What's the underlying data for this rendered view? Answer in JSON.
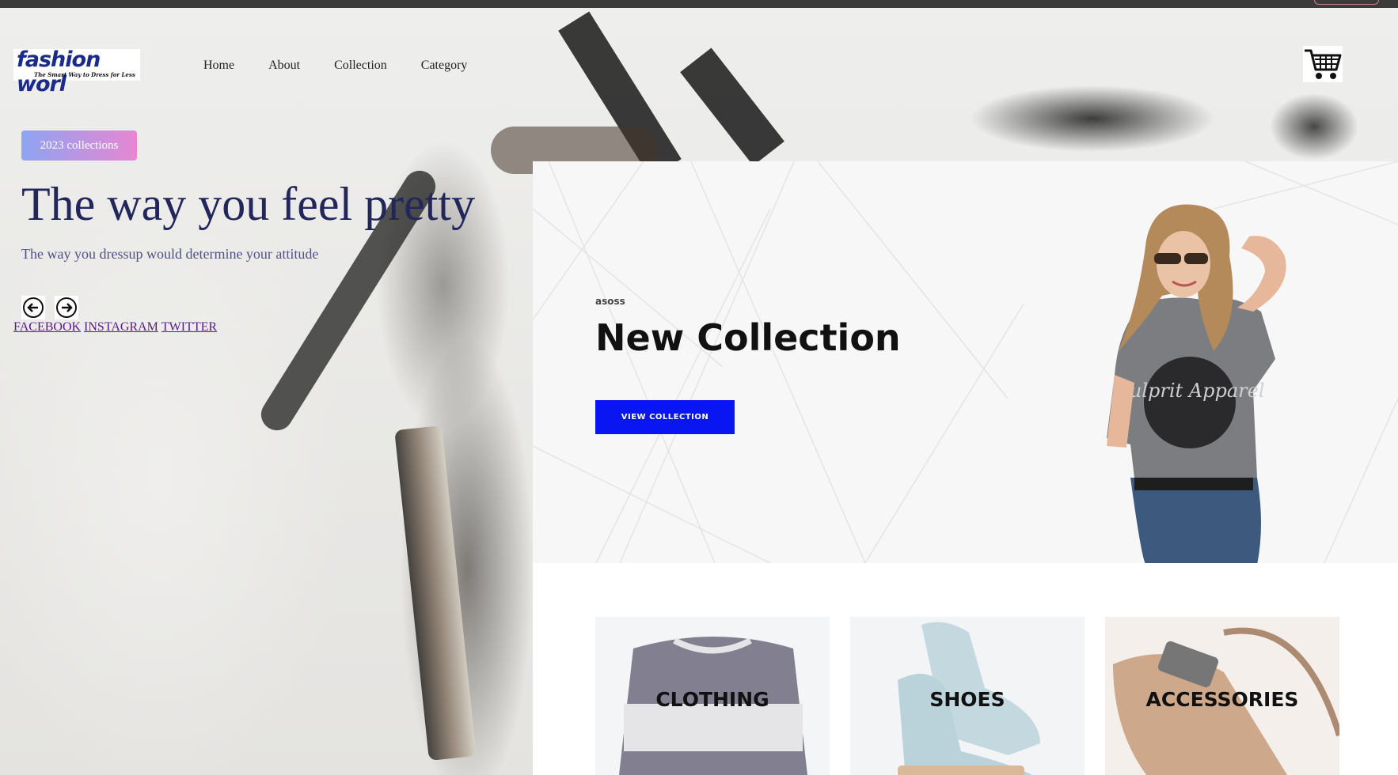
{
  "header": {
    "logo": {
      "name": "fashion worl",
      "tagline": "The Smart Way to Dress for Less"
    },
    "nav": [
      {
        "label": "Home"
      },
      {
        "label": "About"
      },
      {
        "label": "Collection"
      },
      {
        "label": "Category"
      }
    ],
    "cart_icon": "shopping-cart-icon"
  },
  "hero": {
    "badge": "2023 collections",
    "headline": "The way you feel pretty",
    "subline": "The way you dressup would determine your attitude",
    "prev_icon": "arrow-left-icon",
    "next_icon": "arrow-right-icon",
    "social": [
      "FACEBOOK",
      "INSTAGRAM",
      "TWITTER"
    ]
  },
  "banner": {
    "brand": "asoss",
    "title": "New Collection",
    "button": "VIEW COLLECTION",
    "button_color": "#0a16f2",
    "shirt_text": "Culprit Apparel"
  },
  "categories": [
    {
      "label": "CLOTHING"
    },
    {
      "label": "SHOES"
    },
    {
      "label": "ACCESSORIES"
    }
  ],
  "colors": {
    "headline": "#23265a",
    "badge_gradient": [
      "#8ea4f2",
      "#e786d3"
    ],
    "link": "#551a8b"
  }
}
